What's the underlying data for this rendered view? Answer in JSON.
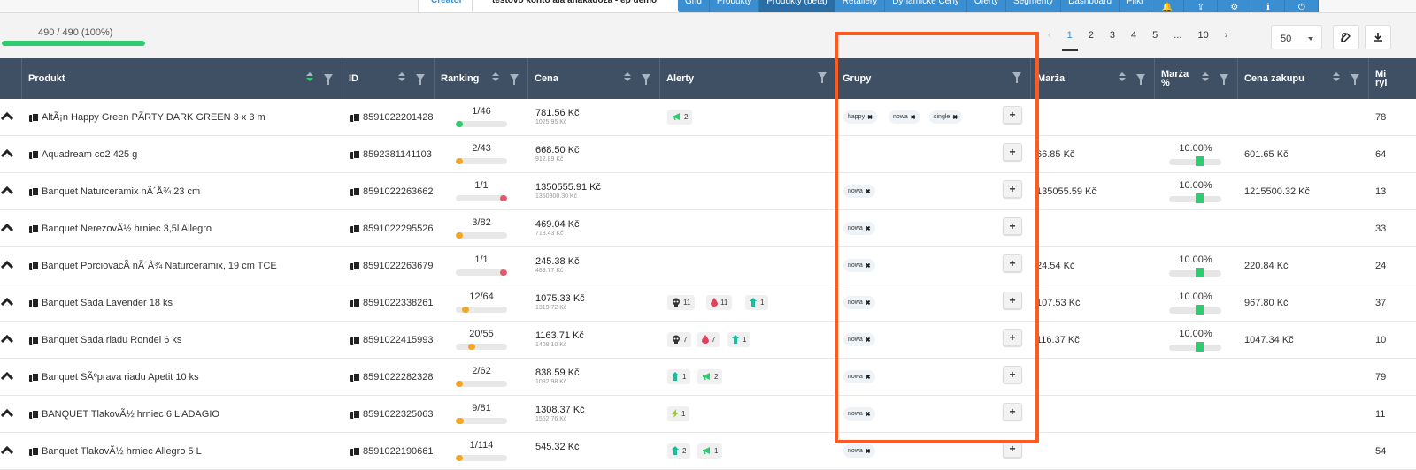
{
  "topbar": {
    "creator_label": "Creator",
    "note": "testovo konto ala anakadoza - ep demo"
  },
  "nav": {
    "items": [
      "Grid",
      "Produkty",
      "Produkty (beta)",
      "Retailery",
      "Dynamické Ceny",
      "Oferty",
      "Segmenty",
      "Dashboard",
      "Pliki"
    ],
    "active_index": 2,
    "icons": [
      "bell-icon",
      "upload-icon",
      "settings-icon",
      "info-icon",
      "power-icon"
    ]
  },
  "toolbar": {
    "progress_text": "490 / 490 (100%)",
    "progress_fraction": 1.0,
    "pagination": {
      "prev": "‹",
      "pages": [
        "1",
        "2",
        "3",
        "4",
        "5"
      ],
      "ellipsis": "...",
      "last": "10",
      "next": "›",
      "active": "1"
    },
    "per_page": "50"
  },
  "columns": {
    "produkt": "Produkt",
    "id": "ID",
    "ranking": "Ranking",
    "cena": "Cena",
    "alerty": "Alerty",
    "grupy": "Grupy",
    "marza": "Marża",
    "marza_pct_1": "Marża",
    "marza_pct_2": "%",
    "cena_zakupu": "Cena zakupu",
    "min_1": "Mi",
    "min_2": "ryi"
  },
  "rows": [
    {
      "name": "AltÃ¡n Happy Green PÃRTY DARK GREEN 3 x 3 m",
      "id": "8591022201428",
      "rank": "1/46",
      "rank_fill": 0.1,
      "rank_color": "#2ecc71",
      "price": "781.56 Kč",
      "price_old": "1025.95 Kč",
      "alerts": [
        {
          "icon": "megaphone",
          "n": "2"
        }
      ],
      "tags": [
        "happy",
        "nowa",
        "single"
      ],
      "marza": "",
      "marza_pct": "",
      "cena_zakupu": "",
      "min": "78"
    },
    {
      "name": "Aquadream co2 425 g",
      "id": "8592381141103",
      "rank": "2/43",
      "rank_fill": 0.12,
      "rank_color": "#f5a623",
      "price": "668.50 Kč",
      "price_old": "912.89 Kč",
      "alerts": [],
      "tags": [],
      "marza": "66.85 Kč",
      "marza_pct": "10.00%",
      "cena_zakupu": "601.65 Kč",
      "min": "64"
    },
    {
      "name": "Banquet Naturceramix nÃ´Å¾ 23 cm",
      "id": "8591022263662",
      "rank": "1/1",
      "rank_fill": 1.0,
      "rank_color": "#e05a6a",
      "price": "1350555.91 Kč",
      "price_old": "1350800.30 Kč",
      "alerts": [],
      "tags": [
        "nowa"
      ],
      "marza": "135055.59 Kč",
      "marza_pct": "10.00%",
      "cena_zakupu": "1215500.32 Kč",
      "min": "13"
    },
    {
      "name": "Banquet NerezovÃ½ hrniec 3,5l Allegro",
      "id": "8591022295526",
      "rank": "3/82",
      "rank_fill": 0.1,
      "rank_color": "#f5a623",
      "price": "469.04 Kč",
      "price_old": "713.43 Kč",
      "alerts": [],
      "tags": [
        "nowa"
      ],
      "marza": "",
      "marza_pct": "",
      "cena_zakupu": "",
      "min": "33"
    },
    {
      "name": "Banquet PorciovacÃ nÃ´Å¾ Naturceramix, 19 cm TCE",
      "id": "8591022263679",
      "rank": "1/1",
      "rank_fill": 1.0,
      "rank_color": "#e05a6a",
      "price": "245.38 Kč",
      "price_old": "489.77 Kč",
      "alerts": [],
      "tags": [
        "nowa"
      ],
      "marza": "24.54 Kč",
      "marza_pct": "10.00%",
      "cena_zakupu": "220.84 Kč",
      "min": "24"
    },
    {
      "name": "Banquet Sada Lavender 18 ks",
      "id": "8591022338261",
      "rank": "12/64",
      "rank_fill": 0.25,
      "rank_color": "#f5a623",
      "price": "1075.33 Kč",
      "price_old": "1319.72 Kč",
      "alerts": [
        {
          "icon": "skull",
          "n": "11"
        },
        {
          "icon": "drop",
          "n": "11"
        },
        {
          "icon": "arrow-up",
          "n": "1"
        }
      ],
      "tags": [
        "nowa"
      ],
      "marza": "107.53 Kč",
      "marza_pct": "10.00%",
      "cena_zakupu": "967.80 Kč",
      "min": "37"
    },
    {
      "name": "Banquet Sada riadu Rondel 6 ks",
      "id": "8591022415993",
      "rank": "20/55",
      "rank_fill": 0.38,
      "rank_color": "#f5a623",
      "price": "1163.71 Kč",
      "price_old": "1408.10 Kč",
      "alerts": [
        {
          "icon": "skull",
          "n": "7"
        },
        {
          "icon": "drop",
          "n": "7"
        },
        {
          "icon": "arrow-up",
          "n": "1"
        }
      ],
      "tags": [
        "nowa"
      ],
      "marza": "116.37 Kč",
      "marza_pct": "10.00%",
      "cena_zakupu": "1047.34 Kč",
      "min": "10"
    },
    {
      "name": "Banquet SÃºprava riadu Apetit 10 ks",
      "id": "8591022282328",
      "rank": "2/62",
      "rank_fill": 0.1,
      "rank_color": "#f5a623",
      "price": "838.59 Kč",
      "price_old": "1082.98 Kč",
      "alerts": [
        {
          "icon": "arrow-up",
          "n": "1"
        },
        {
          "icon": "megaphone",
          "n": "2"
        }
      ],
      "tags": [
        "nowa"
      ],
      "marza": "",
      "marza_pct": "",
      "cena_zakupu": "",
      "min": "79"
    },
    {
      "name": "BANQUET TlakovÃ½ hrniec 6 L ADAGIO",
      "id": "8591022325063",
      "rank": "9/81",
      "rank_fill": 0.15,
      "rank_color": "#f5a623",
      "price": "1308.37 Kč",
      "price_old": "1552.76 Kč",
      "alerts": [
        {
          "icon": "bolt",
          "n": "1"
        }
      ],
      "tags": [
        "nowa"
      ],
      "marza": "",
      "marza_pct": "",
      "cena_zakupu": "",
      "min": "11"
    },
    {
      "name": "Banquet TlakovÃ½ hrniec Allegro 5 L",
      "id": "8591022190661",
      "rank": "1/114",
      "rank_fill": 0.1,
      "rank_color": "#f5a623",
      "price": "545.32 Kč",
      "price_old": "",
      "alerts": [
        {
          "icon": "arrow-up",
          "n": "2"
        },
        {
          "icon": "megaphone",
          "n": "1"
        }
      ],
      "tags": [
        "nowa"
      ],
      "marza": "",
      "marza_pct": "",
      "cena_zakupu": "",
      "min": "54"
    }
  ],
  "colors": {
    "accent": "#3b8fd0",
    "header_bg": "#3f5064",
    "highlight": "#ff5a1f",
    "success": "#2ecc71",
    "warning": "#f5a623",
    "danger": "#e05a6a"
  }
}
